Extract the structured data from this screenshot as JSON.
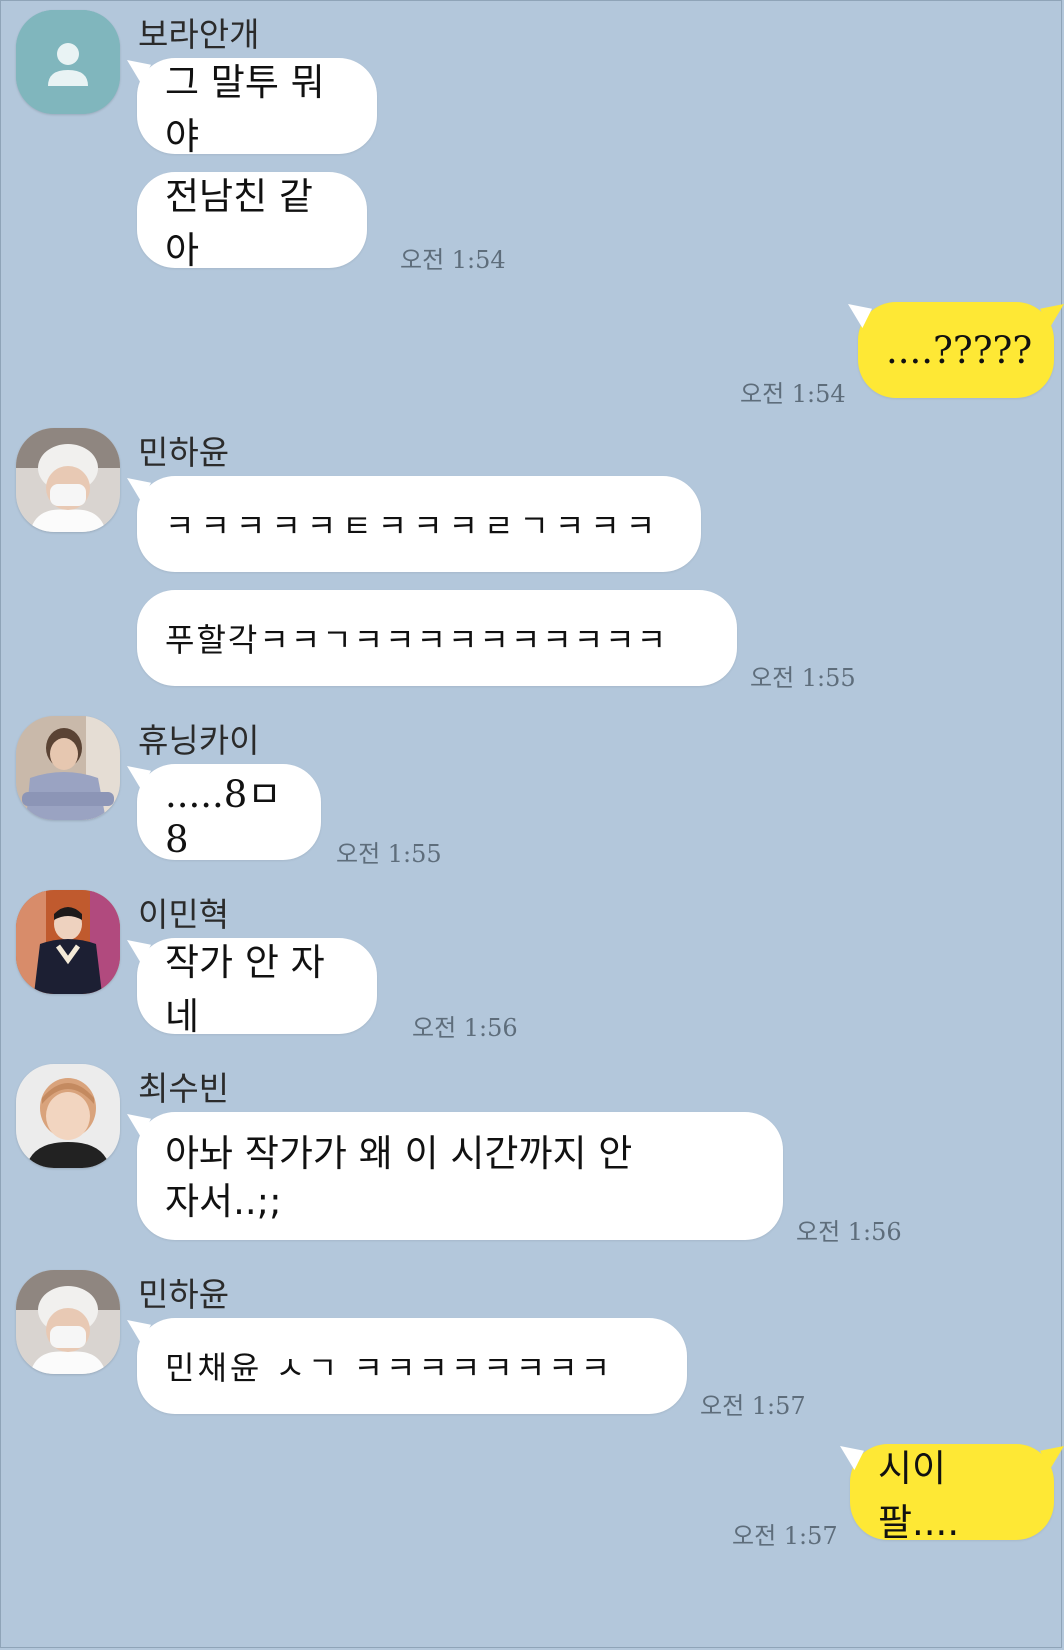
{
  "chat": {
    "messages": [
      {
        "sender": "보라안개",
        "avatar": "default-profile-icon",
        "bubbles": [
          "그 말투 뭐야",
          "전남친 같아"
        ],
        "time": "오전 1:54"
      },
      {
        "sender": "me",
        "bubbles": [
          "....?????"
        ],
        "time": "오전 1:54"
      },
      {
        "sender": "민하윤",
        "avatar": "profile-photo-white-beanie-mask",
        "bubbles": [
          "ㅋㅋㅋㅋㅋㅌㅋㅋㅋㄹㄱㅋㅋㅋ",
          "푸할각ㅋㅋㄱㅋㅋㅋㅋㅋㅋㅋㅋㅋㅋ"
        ],
        "time": "오전 1:55"
      },
      {
        "sender": "휴닝카이",
        "avatar": "profile-photo-grey-sweater",
        "bubbles": [
          ".....8ㅁ8"
        ],
        "time": "오전 1:55"
      },
      {
        "sender": "이민혁",
        "avatar": "profile-photo-dark-jacket",
        "bubbles": [
          "작가 안 자네"
        ],
        "time": "오전 1:56"
      },
      {
        "sender": "최수빈",
        "avatar": "profile-photo-orange-hair",
        "bubbles": [
          "아놔 작가가 왜 이 시간까지 안\n자서..;;"
        ],
        "time": "오전 1:56"
      },
      {
        "sender": "민하윤",
        "avatar": "profile-photo-white-beanie-mask",
        "bubbles": [
          "민채윤 ㅅㄱ ㅋㅋㅋㅋㅋㅋㅋㅋ"
        ],
        "time": "오전 1:57"
      },
      {
        "sender": "me",
        "bubbles": [
          "시이팔...."
        ],
        "time": "오전 1:57"
      }
    ]
  },
  "colors": {
    "background": "#b3c7db",
    "incoming_bubble": "#ffffff",
    "outgoing_bubble": "#fee835"
  }
}
